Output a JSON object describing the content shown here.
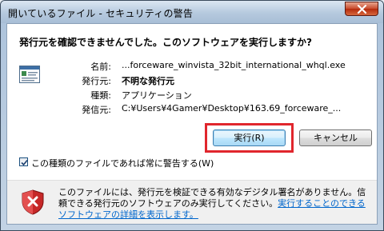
{
  "window": {
    "title": "開いているファイル - セキュリティの警告",
    "close_icon": "close-icon"
  },
  "question": "発行元を確認できませんでした。このソフトウェアを実行しますか?",
  "fields": [
    {
      "label": "名前:",
      "value": "...forceware_winvista_32bit_international_whql.exe",
      "bold": false
    },
    {
      "label": "発行元:",
      "value": "不明な発行元",
      "bold": true
    },
    {
      "label": "種類:",
      "value": "アプリケーション",
      "bold": false
    },
    {
      "label": "発信元:",
      "value": "C:¥Users¥4Gamer¥Desktop¥163.69_forceware_...",
      "bold": false
    }
  ],
  "buttons": {
    "run_label": "実行(R)",
    "cancel_label": "キャンセル"
  },
  "checkbox": {
    "label": "この種類のファイルであれば常に警告する(W)",
    "checked": true
  },
  "footer": {
    "text": "このファイルには、発行元を検証できる有効なデジタル署名がありません。信頼できる発行元のソフトウェアのみ実行してください。",
    "link": "実行することのできるソフトウェアの詳細を表示します。"
  },
  "colors": {
    "highlight": "#e0262d",
    "link": "#0066cc"
  }
}
